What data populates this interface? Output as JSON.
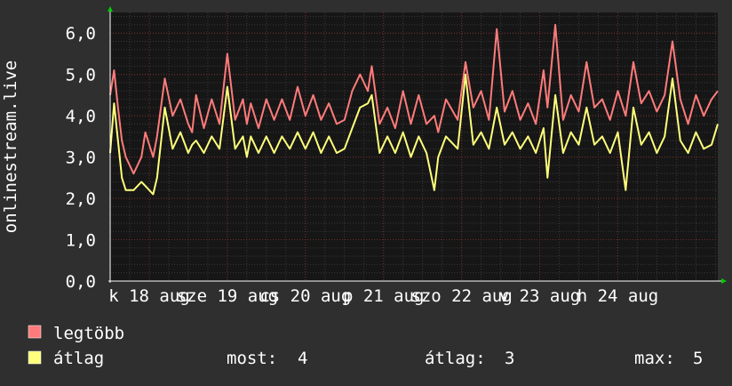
{
  "chart_data": {
    "type": "line",
    "ylabel": "onlinestream.live",
    "ylim": [
      0,
      6.5
    ],
    "y_ticks": [
      {
        "value": 0,
        "label": "0,0"
      },
      {
        "value": 1,
        "label": "1,0"
      },
      {
        "value": 2,
        "label": "2,0"
      },
      {
        "value": 3,
        "label": "3,0"
      },
      {
        "value": 4,
        "label": "4,0"
      },
      {
        "value": 5,
        "label": "5,0"
      },
      {
        "value": 6,
        "label": "6,0"
      }
    ],
    "xlim": [
      0,
      7.78
    ],
    "x_ticks": [
      {
        "value": 0.5,
        "label": "k 18 aug"
      },
      {
        "value": 1.5,
        "label": "sze 19 aug"
      },
      {
        "value": 2.5,
        "label": "cs 20 aug"
      },
      {
        "value": 3.5,
        "label": "p 21 aug"
      },
      {
        "value": 4.5,
        "label": "szo 22 aug"
      },
      {
        "value": 5.5,
        "label": "v 23 aug"
      },
      {
        "value": 6.5,
        "label": "h 24 aug"
      }
    ],
    "grid": true,
    "series": [
      {
        "name": "legtöbb",
        "color": "#ff7b7b",
        "x": [
          0.0,
          0.05,
          0.1,
          0.15,
          0.2,
          0.3,
          0.4,
          0.45,
          0.55,
          0.6,
          0.7,
          0.8,
          0.9,
          1.0,
          1.05,
          1.1,
          1.2,
          1.3,
          1.4,
          1.5,
          1.6,
          1.7,
          1.75,
          1.8,
          1.9,
          2.0,
          2.1,
          2.2,
          2.3,
          2.4,
          2.5,
          2.6,
          2.7,
          2.8,
          2.9,
          3.0,
          3.1,
          3.2,
          3.3,
          3.35,
          3.45,
          3.55,
          3.65,
          3.75,
          3.85,
          3.95,
          4.05,
          4.15,
          4.2,
          4.3,
          4.45,
          4.55,
          4.65,
          4.75,
          4.85,
          4.95,
          5.05,
          5.15,
          5.25,
          5.35,
          5.45,
          5.55,
          5.6,
          5.7,
          5.8,
          5.9,
          6.0,
          6.1,
          6.2,
          6.3,
          6.4,
          6.5,
          6.6,
          6.7,
          6.8,
          6.9,
          7.0,
          7.1,
          7.2,
          7.3,
          7.4,
          7.5,
          7.6,
          7.7,
          7.78
        ],
        "y": [
          4.5,
          5.1,
          4.2,
          3.4,
          3.0,
          2.6,
          3.0,
          3.6,
          3.0,
          3.5,
          4.9,
          4.0,
          4.4,
          3.8,
          3.6,
          4.5,
          3.7,
          4.4,
          3.8,
          5.5,
          3.9,
          4.4,
          3.8,
          4.3,
          3.7,
          4.4,
          3.9,
          4.4,
          3.9,
          4.7,
          4.0,
          4.5,
          3.9,
          4.3,
          3.8,
          3.9,
          4.6,
          5.0,
          4.6,
          5.2,
          3.8,
          4.2,
          3.7,
          4.6,
          3.8,
          4.5,
          3.8,
          4.0,
          3.6,
          4.4,
          3.9,
          5.3,
          4.2,
          4.6,
          3.9,
          6.1,
          4.1,
          4.6,
          3.9,
          4.3,
          3.8,
          5.1,
          4.2,
          6.2,
          3.9,
          4.5,
          4.1,
          5.3,
          4.2,
          4.4,
          3.9,
          4.6,
          4.0,
          5.3,
          4.3,
          4.6,
          4.1,
          4.5,
          5.8,
          4.4,
          3.8,
          4.5,
          4.0,
          4.4,
          4.6
        ]
      },
      {
        "name": "átlag",
        "color": "#ffff7b",
        "x": [
          0.0,
          0.05,
          0.1,
          0.15,
          0.2,
          0.3,
          0.4,
          0.45,
          0.55,
          0.6,
          0.7,
          0.8,
          0.9,
          1.0,
          1.05,
          1.1,
          1.2,
          1.3,
          1.4,
          1.5,
          1.6,
          1.7,
          1.75,
          1.8,
          1.9,
          2.0,
          2.1,
          2.2,
          2.3,
          2.4,
          2.5,
          2.6,
          2.7,
          2.8,
          2.9,
          3.0,
          3.1,
          3.2,
          3.3,
          3.35,
          3.45,
          3.55,
          3.65,
          3.75,
          3.85,
          3.95,
          4.05,
          4.15,
          4.2,
          4.3,
          4.45,
          4.55,
          4.65,
          4.75,
          4.85,
          4.95,
          5.05,
          5.15,
          5.25,
          5.35,
          5.45,
          5.55,
          5.6,
          5.7,
          5.8,
          5.9,
          6.0,
          6.1,
          6.2,
          6.3,
          6.4,
          6.5,
          6.6,
          6.7,
          6.8,
          6.9,
          7.0,
          7.1,
          7.2,
          7.3,
          7.4,
          7.5,
          7.6,
          7.7,
          7.78
        ],
        "y": [
          3.1,
          4.3,
          3.4,
          2.5,
          2.2,
          2.2,
          2.4,
          2.3,
          2.1,
          2.5,
          4.2,
          3.2,
          3.6,
          3.1,
          3.3,
          3.4,
          3.1,
          3.5,
          3.2,
          4.7,
          3.2,
          3.5,
          3.0,
          3.5,
          3.1,
          3.5,
          3.1,
          3.5,
          3.2,
          3.6,
          3.2,
          3.6,
          3.1,
          3.5,
          3.1,
          3.2,
          3.7,
          4.2,
          4.3,
          4.5,
          3.1,
          3.5,
          3.1,
          3.6,
          3.0,
          3.5,
          3.1,
          2.2,
          3.0,
          3.5,
          3.2,
          5.0,
          3.3,
          3.6,
          3.2,
          4.2,
          3.3,
          3.6,
          3.2,
          3.5,
          3.1,
          3.7,
          2.5,
          4.5,
          3.1,
          3.6,
          3.3,
          4.2,
          3.3,
          3.5,
          3.1,
          3.6,
          2.2,
          4.2,
          3.3,
          3.6,
          3.1,
          3.5,
          4.9,
          3.4,
          3.1,
          3.6,
          3.2,
          3.3,
          3.8
        ]
      }
    ],
    "legend": {
      "position": "bottom-left",
      "stats": [
        {
          "label": "most:",
          "value": "4"
        },
        {
          "label": "átlag:",
          "value": "3"
        },
        {
          "label": "max:",
          "value": "5"
        }
      ]
    }
  }
}
